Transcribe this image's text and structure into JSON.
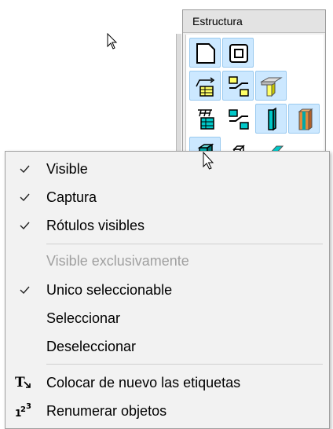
{
  "panel": {
    "title": "Estructura"
  },
  "menu": {
    "items": [
      {
        "label": "Visible",
        "checked": true
      },
      {
        "label": "Captura",
        "checked": true
      },
      {
        "label": "Rótulos visibles",
        "checked": true
      },
      {
        "label": "Visible exclusivamente",
        "checked": false,
        "disabled": true
      },
      {
        "label": "Unico seleccionable",
        "checked": true
      },
      {
        "label": "Seleccionar",
        "checked": false
      },
      {
        "label": "Deseleccionar",
        "checked": false
      },
      {
        "label": "Colocar de nuevo las etiquetas",
        "icon": "text-reposition-icon"
      },
      {
        "label": "Renumerar objetos",
        "icon": "renumber-icon"
      }
    ]
  }
}
